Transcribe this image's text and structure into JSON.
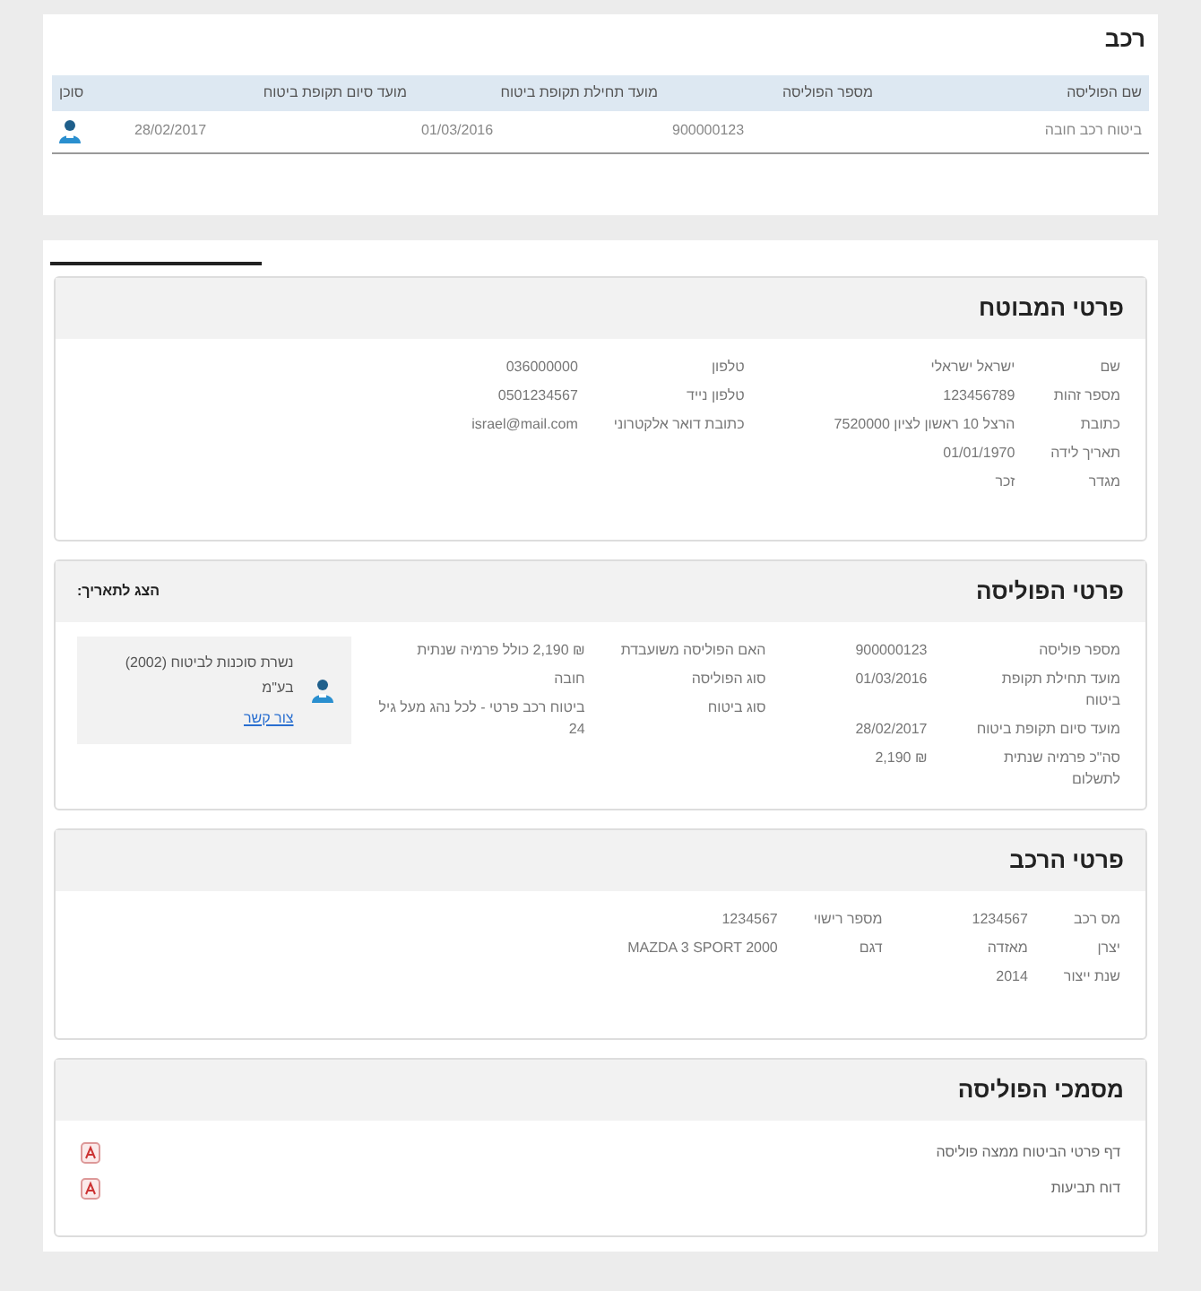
{
  "vehicle_table": {
    "title": "רכב",
    "columns": [
      "שם הפוליסה",
      "מספר הפוליסה",
      "מועד תחילת תקופת ביטוח",
      "מועד סיום תקופת ביטוח",
      "סוכן"
    ],
    "rows": [
      {
        "cells": [
          "ביטוח רכב חובה",
          "900000123",
          "01/03/2016",
          "28/02/2017"
        ]
      }
    ]
  },
  "insured": {
    "title": "פרטי המבוטח",
    "columns": [
      [
        {
          "label": "שם",
          "value": "ישראל ישראלי"
        },
        {
          "label": "מספר זהות",
          "value": "123456789"
        },
        {
          "label": "כתובת",
          "value": "הרצל 10 ראשון לציון 7520000"
        },
        {
          "label": "תאריך לידה",
          "value": "01/01/1970"
        },
        {
          "label": "מגדר",
          "value": "זכר"
        }
      ],
      [
        {
          "label": "טלפון",
          "value": "036000000"
        },
        {
          "label": "טלפון נייד",
          "value": "0501234567"
        },
        {
          "label": "כתובת דואר אלקטרוני",
          "value": "israel@mail.com"
        }
      ]
    ]
  },
  "policy": {
    "title": "פרטי הפוליסה",
    "date_filter": "הצג לתאריך:",
    "columns": [
      [
        {
          "label": "מספר פוליסה",
          "value": "900000123"
        },
        {
          "label": "מועד תחילת תקופת ביטוח",
          "value": "01/03/2016"
        },
        {
          "label": "מועד סיום תקופת ביטוח",
          "value": "28/02/2017"
        },
        {
          "label": "סה\"כ פרמיה שנתית לתשלום",
          "value": "₪ 2,190"
        }
      ],
      [
        {
          "label": "האם הפוליסה משועבדת",
          "value": "₪ 2,190 כולל פרמיה שנתית"
        },
        {
          "label": "סוג הפוליסה",
          "value": "חובה"
        },
        {
          "label": "סוג ביטוח",
          "value": "ביטוח רכב פרטי - לכל נהג מעל גיל 24"
        }
      ]
    ],
    "agent": {
      "name": "נשרת סוכנות לביטוח (2002) בע\"מ",
      "link": "צור קשר"
    }
  },
  "vehicle": {
    "title": "פרטי הרכב",
    "columns": [
      [
        {
          "label": "מס רכב",
          "value": "1234567"
        },
        {
          "label": "יצרן",
          "value": "מאזדה"
        },
        {
          "label": "שנת ייצור",
          "value": "2014"
        }
      ],
      [
        {
          "label": "מספר רישוי",
          "value": "1234567"
        },
        {
          "label": "דגם",
          "value": "MAZDA 3 SPORT 2000"
        }
      ]
    ]
  },
  "documents": {
    "title": "מסמכי הפוליסה",
    "items": [
      {
        "label": "דף פרטי הביטוח ממצה פוליסה"
      },
      {
        "label": "דוח תביעות"
      }
    ]
  }
}
